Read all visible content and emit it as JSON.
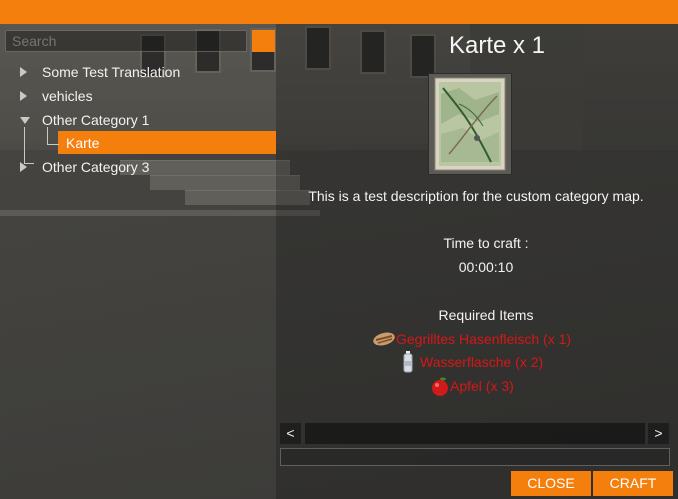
{
  "search": {
    "placeholder": "Search"
  },
  "tree": {
    "items": [
      {
        "label": "Some Test Translation",
        "expanded": false
      },
      {
        "label": "vehicles",
        "expanded": false
      },
      {
        "label": "Other Category 1",
        "expanded": true,
        "children": [
          {
            "label": "Karte",
            "selected": true
          }
        ]
      },
      {
        "label": "Other Category 3",
        "expanded": false
      }
    ]
  },
  "detail": {
    "title": "Karte x 1",
    "description": "This is a test description for the custom category map.",
    "time_label": "Time to craft :",
    "time_value": "00:00:10",
    "required_title": "Required Items",
    "required_items": [
      {
        "label": "Gegrilltes Hasenfleisch (x 1)",
        "icon": "grilled-meat-icon"
      },
      {
        "label": "Wasserflasche (x 2)",
        "icon": "water-bottle-icon"
      },
      {
        "label": "Apfel (x 3)",
        "icon": "apple-icon"
      }
    ]
  },
  "controls": {
    "scroll_left": "<",
    "scroll_right": ">",
    "close_label": "CLOSE",
    "craft_label": "CRAFT"
  },
  "colors": {
    "accent": "#f47f0c",
    "required_text": "#d61717"
  }
}
